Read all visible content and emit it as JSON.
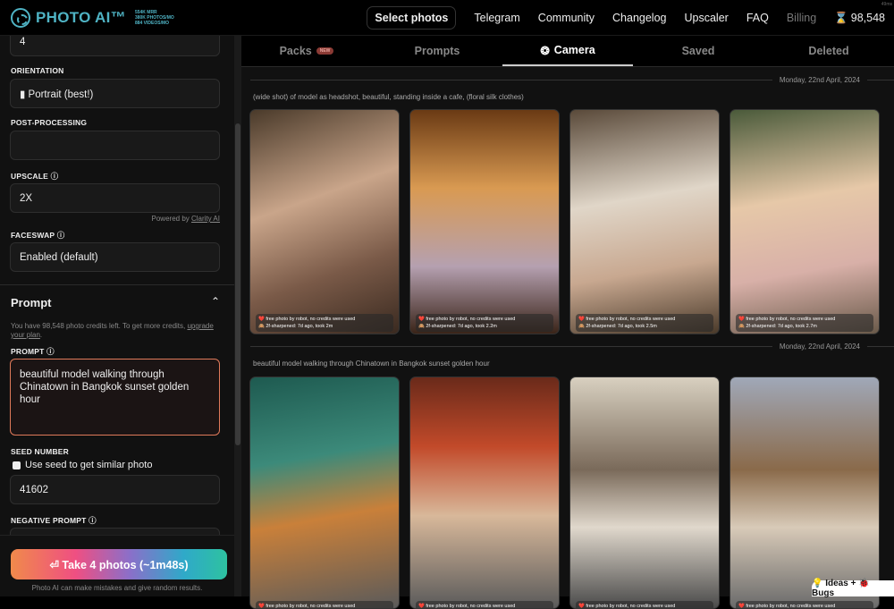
{
  "header": {
    "logo": "PHOTO AI™",
    "stats": [
      "554K MRR",
      "380K PHOTOS/MO",
      "884 VIDEOS/MO"
    ],
    "nav": {
      "select": "Select photos",
      "telegram": "Telegram",
      "community": "Community",
      "changelog": "Changelog",
      "upscaler": "Upscaler",
      "faq": "FAQ",
      "billing": "Billing",
      "credits": "98,548"
    },
    "ms": "49ms"
  },
  "sidebar": {
    "count_value": "4",
    "orientation_label": "ORIENTATION",
    "orientation_value": "▮ Portrait (best!)",
    "post_label": "POST-PROCESSING",
    "post_value": "",
    "upscale_label": "UPSCALE",
    "upscale_value": "2X",
    "powered": "Powered by ",
    "clarity": "Clarity AI",
    "faceswap_label": "FACESWAP",
    "faceswap_value": "Enabled (default)",
    "prompt_section": "Prompt",
    "credits_text": "You have 98,548 photo credits left. To get more credits, ",
    "upgrade": "upgrade your plan",
    "prompt_label": "PROMPT",
    "prompt_value": "beautiful model walking through Chinatown in Bangkok sunset golden hour",
    "seed_label": "SEED NUMBER",
    "seed_checkbox": "Use seed to get similar photo",
    "seed_value": "41602",
    "neg_label": "NEGATIVE PROMPT",
    "take_button": "⏎ Take 4 photos (~1m48s)",
    "disclaimer": "Photo AI can make mistakes and give random results."
  },
  "tabs": [
    {
      "label": "Packs",
      "badge": "NEW"
    },
    {
      "label": "Prompts"
    },
    {
      "label": "Camera"
    },
    {
      "label": "Saved"
    },
    {
      "label": "Deleted"
    }
  ],
  "groups": [
    {
      "date": "Monday, 22nd April, 2024",
      "prompt": "(wide shot) of model as headshot, beautiful, standing inside a cafe, (floral silk clothes)",
      "photos": [
        {
          "line1": "❤️ free photo by robot, no credits were used",
          "line2": "🙈 2f-sharpened: 7d ago, took 2m"
        },
        {
          "line1": "❤️ free photo by robot, no credits were used",
          "line2": "🙈 2f-sharpened: 7d ago, took 2.2m"
        },
        {
          "line1": "❤️ free photo by robot, no credits were used",
          "line2": "🙈 2f-sharpened: 7d ago, took 2.5m"
        },
        {
          "line1": "❤️ free photo by robot, no credits were used",
          "line2": "🙈 2f-sharpened: 7d ago, took 2.7m"
        }
      ]
    },
    {
      "date": "Monday, 22nd April, 2024",
      "prompt": "beautiful model walking through Chinatown in Bangkok sunset golden hour",
      "photos": [
        {
          "line1": "❤️ free photo by robot, no credits were used"
        },
        {
          "line1": "❤️ free photo by robot, no credits were used"
        },
        {
          "line1": "❤️ free photo by robot, no credits were used"
        },
        {
          "line1": "❤️ free photo by robot, no credits were used"
        }
      ]
    }
  ],
  "ideas": "💡 Ideas + 🐞 Bugs"
}
